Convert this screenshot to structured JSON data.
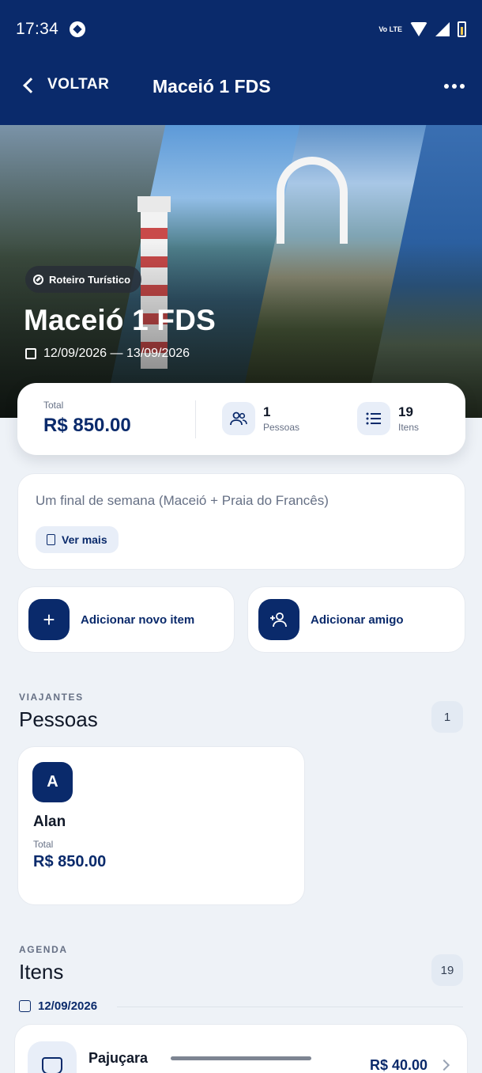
{
  "status": {
    "time": "17:34",
    "network": "Vo LTE"
  },
  "appbar": {
    "back_label": "VOLTAR",
    "title": "Maceió 1 FDS"
  },
  "hero": {
    "chip": "Roteiro Turístico",
    "title": "Maceió 1 FDS",
    "dates": "12/09/2026 — 13/09/2026"
  },
  "summary": {
    "total_label": "Total",
    "total_value": "R$ 850.00",
    "people_count": "1",
    "people_label": "Pessoas",
    "items_count": "19",
    "items_label": "Itens"
  },
  "description": {
    "text": "Um final de semana (Maceió + Praia do Francês)",
    "more_label": "Ver mais"
  },
  "actions": {
    "add_item": "Adicionar novo item",
    "add_friend": "Adicionar amigo"
  },
  "travelers": {
    "eyebrow": "VIAJANTES",
    "title": "Pessoas",
    "count": "1",
    "people": [
      {
        "initial": "A",
        "name": "Alan",
        "total_label": "Total",
        "total": "R$ 850.00"
      }
    ]
  },
  "agenda": {
    "eyebrow": "AGENDA",
    "title": "Itens",
    "count": "19",
    "date": "12/09/2026",
    "items": [
      {
        "name": "Pajuçara",
        "price": "R$ 40.00",
        "icon": "food-icon"
      }
    ]
  },
  "colors": {
    "primary": "#0a2a6b",
    "background": "#eef2f7",
    "card": "#ffffff"
  }
}
